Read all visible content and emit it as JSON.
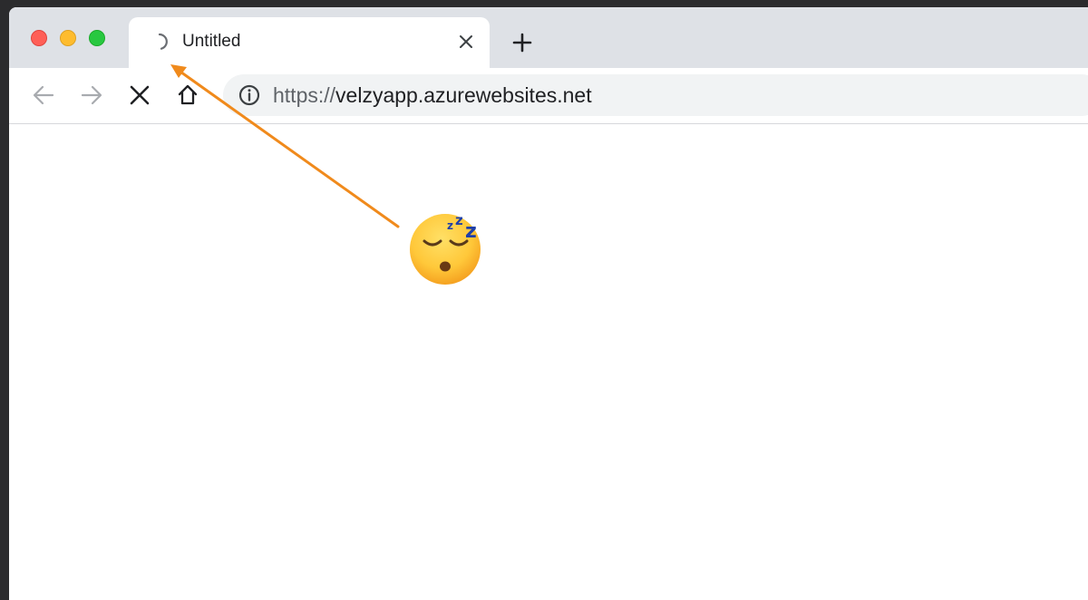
{
  "window": {
    "traffic_lights": [
      {
        "name": "close",
        "color": "#ff5f57"
      },
      {
        "name": "minimize",
        "color": "#febc2e"
      },
      {
        "name": "maximize",
        "color": "#28c840"
      }
    ]
  },
  "tab": {
    "title": "Untitled",
    "loading_icon": "loading-spinner-icon",
    "close_icon": "close-icon"
  },
  "new_tab_icon": "plus-icon",
  "toolbar": {
    "back_icon": "arrow-left-icon",
    "forward_icon": "arrow-right-icon",
    "stop_icon": "stop-x-icon",
    "home_icon": "home-icon"
  },
  "omnibox": {
    "info_icon": "info-icon",
    "url_scheme": "https://",
    "url_host": "velzyapp.azurewebsites.net"
  },
  "annotation": {
    "arrow_color": "#f08a1c",
    "emoji": "sleeping-face-emoji"
  }
}
